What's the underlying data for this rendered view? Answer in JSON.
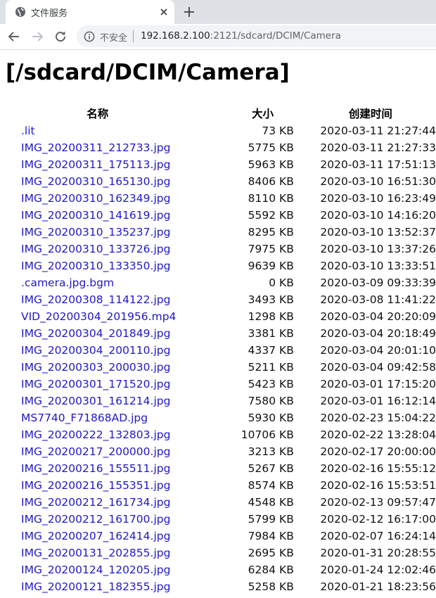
{
  "browser": {
    "tab_title": "文件服务",
    "security_label": "不安全",
    "url_host": "192.168.2.100",
    "url_rest": ":2121/sdcard/DCIM/Camera"
  },
  "page": {
    "heading": "[/sdcard/DCIM/Camera]",
    "columns": {
      "name": "名称",
      "size": "大小",
      "date": "创建时间"
    },
    "files": [
      {
        "name": ".lit",
        "size": "73 KB",
        "date": "2020-03-11 21:27:44"
      },
      {
        "name": "IMG_20200311_212733.jpg",
        "size": "5775 KB",
        "date": "2020-03-11 21:27:33"
      },
      {
        "name": "IMG_20200311_175113.jpg",
        "size": "5963 KB",
        "date": "2020-03-11 17:51:13"
      },
      {
        "name": "IMG_20200310_165130.jpg",
        "size": "8406 KB",
        "date": "2020-03-10 16:51:30"
      },
      {
        "name": "IMG_20200310_162349.jpg",
        "size": "8110 KB",
        "date": "2020-03-10 16:23:49"
      },
      {
        "name": "IMG_20200310_141619.jpg",
        "size": "5592 KB",
        "date": "2020-03-10 14:16:20"
      },
      {
        "name": "IMG_20200310_135237.jpg",
        "size": "8295 KB",
        "date": "2020-03-10 13:52:37"
      },
      {
        "name": "IMG_20200310_133726.jpg",
        "size": "7975 KB",
        "date": "2020-03-10 13:37:26"
      },
      {
        "name": "IMG_20200310_133350.jpg",
        "size": "9639 KB",
        "date": "2020-03-10 13:33:51"
      },
      {
        "name": ".camera.jpg.bgm",
        "size": "0 KB",
        "date": "2020-03-09 09:33:39"
      },
      {
        "name": "IMG_20200308_114122.jpg",
        "size": "3493 KB",
        "date": "2020-03-08 11:41:22"
      },
      {
        "name": "VID_20200304_201956.mp4",
        "size": "1298 KB",
        "date": "2020-03-04 20:20:09"
      },
      {
        "name": "IMG_20200304_201849.jpg",
        "size": "3381 KB",
        "date": "2020-03-04 20:18:49"
      },
      {
        "name": "IMG_20200304_200110.jpg",
        "size": "4337 KB",
        "date": "2020-03-04 20:01:10"
      },
      {
        "name": "IMG_20200303_200030.jpg",
        "size": "5211 KB",
        "date": "2020-03-04 09:42:58"
      },
      {
        "name": "IMG_20200301_171520.jpg",
        "size": "5423 KB",
        "date": "2020-03-01 17:15:20"
      },
      {
        "name": "IMG_20200301_161214.jpg",
        "size": "7580 KB",
        "date": "2020-03-01 16:12:14"
      },
      {
        "name": "MS7740_F71868AD.jpg",
        "size": "5930 KB",
        "date": "2020-02-23 15:04:22"
      },
      {
        "name": "IMG_20200222_132803.jpg",
        "size": "10706 KB",
        "date": "2020-02-22 13:28:04"
      },
      {
        "name": "IMG_20200217_200000.jpg",
        "size": "3213 KB",
        "date": "2020-02-17 20:00:00"
      },
      {
        "name": "IMG_20200216_155511.jpg",
        "size": "5267 KB",
        "date": "2020-02-16 15:55:12"
      },
      {
        "name": "IMG_20200216_155351.jpg",
        "size": "8574 KB",
        "date": "2020-02-16 15:53:51"
      },
      {
        "name": "IMG_20200212_161734.jpg",
        "size": "4548 KB",
        "date": "2020-02-13 09:57:47"
      },
      {
        "name": "IMG_20200212_161700.jpg",
        "size": "5799 KB",
        "date": "2020-02-12 16:17:00"
      },
      {
        "name": "IMG_20200207_162414.jpg",
        "size": "7984 KB",
        "date": "2020-02-07 16:24:14"
      },
      {
        "name": "IMG_20200131_202855.jpg",
        "size": "2695 KB",
        "date": "2020-01-31 20:28:55"
      },
      {
        "name": "IMG_20200124_120205.jpg",
        "size": "6284 KB",
        "date": "2020-01-24 12:02:46"
      },
      {
        "name": "IMG_20200121_182355.jpg",
        "size": "5258 KB",
        "date": "2020-01-21 18:23:56"
      }
    ]
  },
  "icons": {
    "tab": "globe-icon",
    "close": "close-icon",
    "new_tab": "plus-icon",
    "back": "arrow-left-icon",
    "forward": "arrow-right-icon",
    "reload": "reload-icon",
    "site_info": "info-icon"
  },
  "colors": {
    "link": "#2018c8",
    "tabstrip": "#dee1e6",
    "omnibox": "#f1f3f4"
  }
}
